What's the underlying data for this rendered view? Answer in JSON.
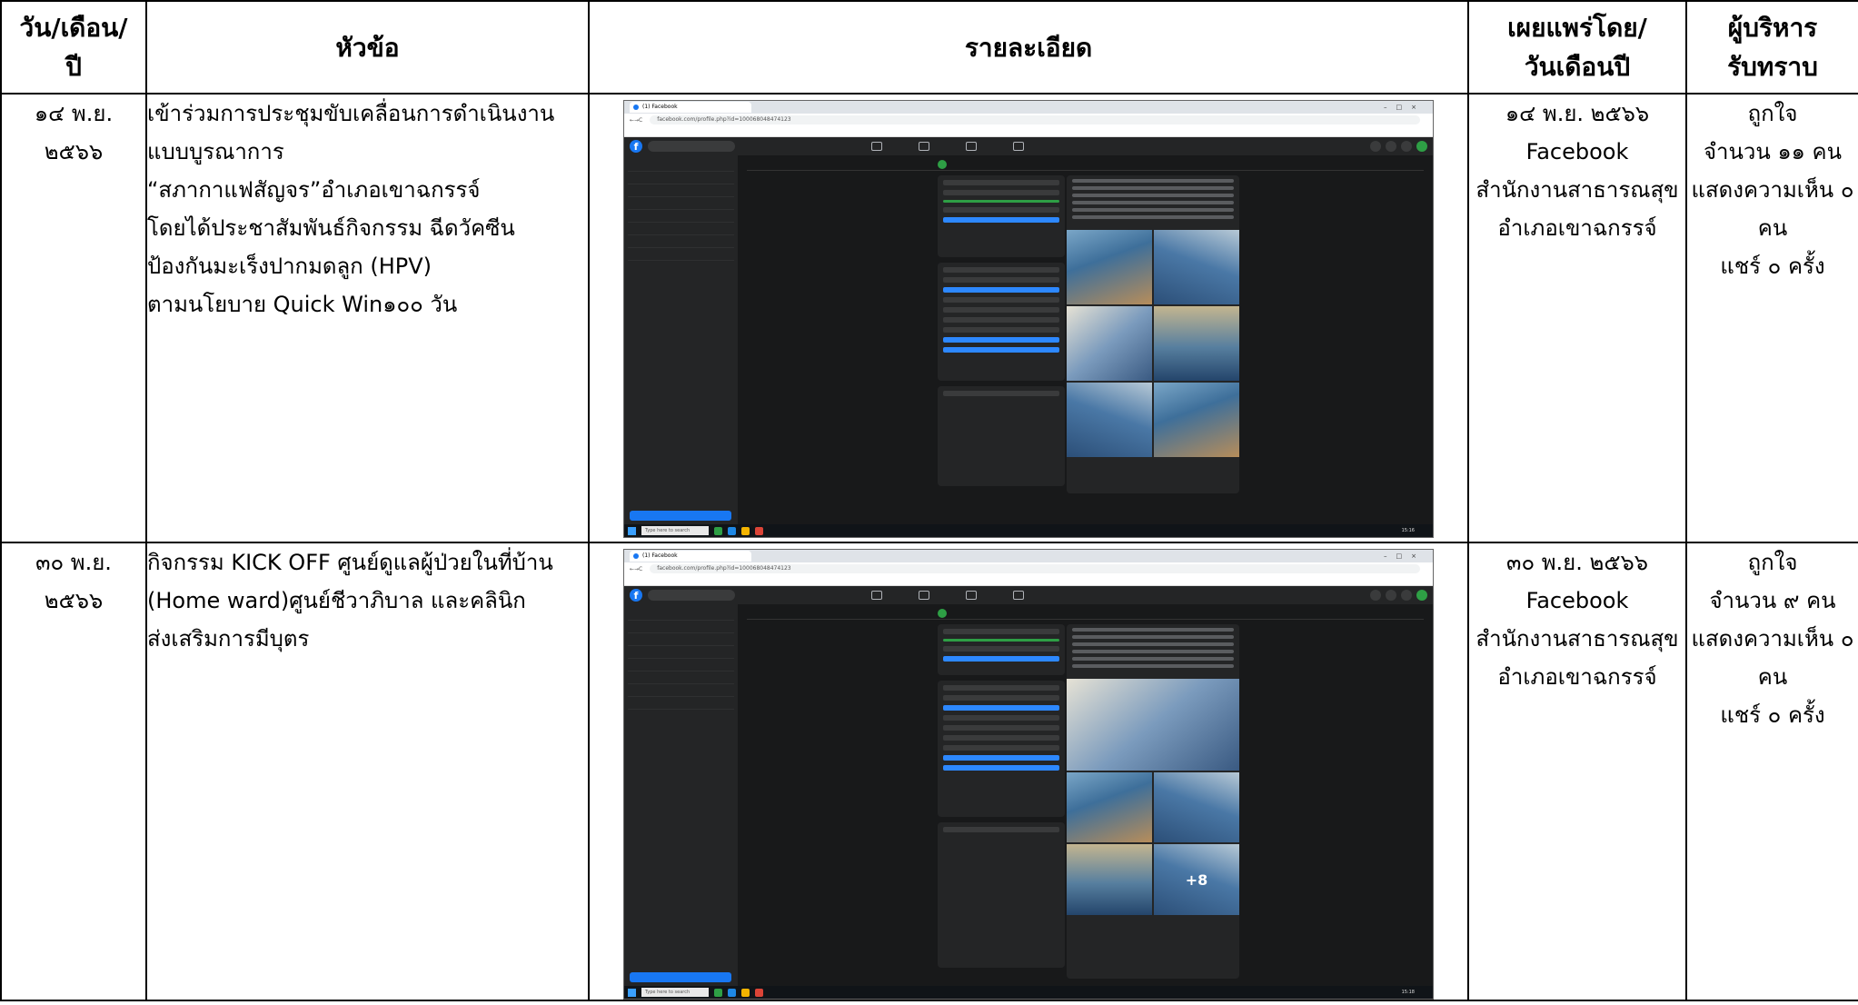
{
  "headers": {
    "date": "วัน/เดือน/ปี",
    "topic": "หัวข้อ",
    "detail": "รายละเอียด",
    "published_by": "เผยแพร่โดย/วันเดือนปี",
    "executive": "ผู้บริหารรับทราบ"
  },
  "header_lines": {
    "date": [
      "วัน/เดือน/",
      "ปี"
    ],
    "published_by": [
      "เผยแพร่โดย/",
      "วันเดือนปี"
    ],
    "executive": [
      "ผู้บริหาร",
      "รับทราบ"
    ]
  },
  "rows": [
    {
      "date_lines": [
        "๑๔ พ.ย.",
        "๒๕๖๖"
      ],
      "topic_lines": [
        "เข้าร่วมการประชุมขับเคลื่อนการดำเนินงาน",
        "แบบบูรณาการ",
        "“สภากาแฟสัญจร”อำเภอเขาฉกรรจ์",
        " โดยได้ประชาสัมพันธ์กิจกรรม ฉีดวัคซีน",
        "ป้องกันมะเร็งปากมดลูก (HPV)",
        "ตามนโยบาย Quick Win๑๐๐ วัน"
      ],
      "screenshot": {
        "tab_title": "(1) Facebook",
        "url": "facebook.com/profile.php?id=100068048474123",
        "search": "Type here to search",
        "clock": "15:16"
      },
      "published_lines": [
        "๑๔ พ.ย. ๒๕๖๖",
        "Facebook",
        "สำนักงานสาธารณสุข",
        "อำเภอเขาฉกรรจ์"
      ],
      "exec_lines": [
        "ถูกใจ",
        "จำนวน ๑๑ คน",
        "แสดงความเห็น ๐",
        "คน",
        "แชร์ ๐ ครั้ง"
      ]
    },
    {
      "date_lines": [
        "๓๐ พ.ย.",
        "๒๕๖๖"
      ],
      "topic_lines": [
        "กิจกรรม KICK OFF ศูนย์ดูแลผู้ป่วยในที่บ้าน",
        "(Home ward)ศูนย์ชีวาภิบาล และคลินิก",
        "ส่งเสริมการมีบุตร"
      ],
      "screenshot": {
        "tab_title": "(1) Facebook",
        "url": "facebook.com/profile.php?id=100068048474123",
        "search": "Type here to search",
        "clock": "15:18",
        "more_photos": "+8"
      },
      "published_lines": [
        "๓๐ พ.ย. ๒๕๖๖",
        "Facebook",
        "สำนักงานสาธารณสุข",
        "อำเภอเขาฉกรรจ์"
      ],
      "exec_lines": [
        "ถูกใจ",
        "จำนวน ๙ คน",
        "แสดงความเห็น ๐",
        "คน",
        "แชร์ ๐ ครั้ง"
      ]
    }
  ]
}
